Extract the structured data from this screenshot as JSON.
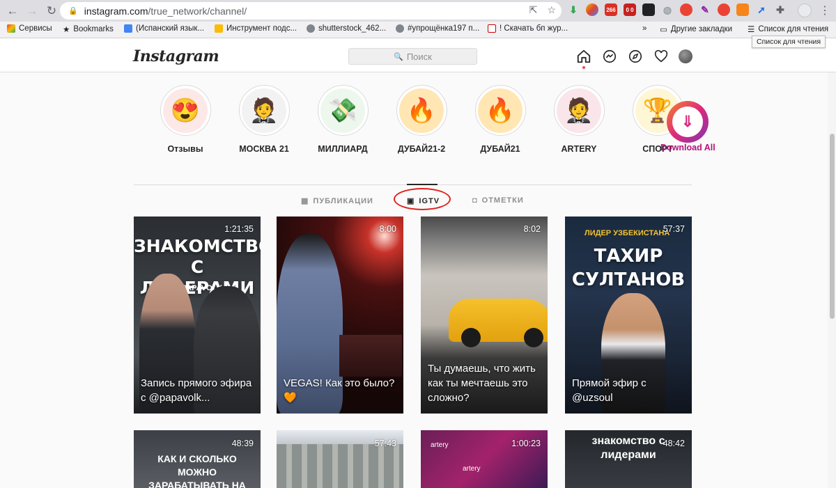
{
  "browser": {
    "url_host": "instagram.com",
    "url_path": "/true_network/channel/",
    "ext_badges": [
      "266",
      "0 0"
    ],
    "bookmarks": [
      {
        "label": "Сервисы"
      },
      {
        "label": "Bookmarks"
      },
      {
        "label": "(Испанский язык..."
      },
      {
        "label": "Инструмент подс..."
      },
      {
        "label": "shutterstock_462..."
      },
      {
        "label": "#упрощёнка197 п..."
      },
      {
        "label": "! Скачать бп жур..."
      }
    ],
    "bookmarks_more": "»",
    "other_bookmarks": "Другие закладки",
    "reading_list": "Список для чтения",
    "tooltip": "Список для чтения"
  },
  "instagram": {
    "logo": "Instagram",
    "search_placeholder": "Поиск",
    "stories": [
      {
        "label": "Отзывы",
        "emoji": "😍"
      },
      {
        "label": "МОСКВА 21",
        "emoji": "🤵"
      },
      {
        "label": "МИЛЛИАРД",
        "emoji": "💸"
      },
      {
        "label": "ДУБАЙ21-2",
        "emoji": "🔥"
      },
      {
        "label": "ДУБАЙ21",
        "emoji": "🔥"
      },
      {
        "label": "ARTERY",
        "emoji": "🤵"
      },
      {
        "label": "СПОРТ",
        "emoji": "🏆"
      }
    ],
    "download_all": "Download All",
    "tabs": [
      {
        "label": "ПУБЛИКАЦИИ",
        "active": false
      },
      {
        "label": "IGTV",
        "active": true
      },
      {
        "label": "ОТМЕТКИ",
        "active": false
      }
    ],
    "videos": [
      {
        "duration": "1:21:35",
        "title_line1": "ЗНАКОМСТВО",
        "title_line2": "С ЛИДЕРАМИ",
        "handle": "PAPAVOLK",
        "caption": "Запись прямого эфира с @papavolk..."
      },
      {
        "duration": "8:00",
        "caption": "VEGAS! Как это было? 🧡"
      },
      {
        "duration": "8:02",
        "caption": "Ты думаешь, что жить как ты мечтаешь это сложно?"
      },
      {
        "duration": "57:37",
        "subtitle": "ЛИДЕР УЗБЕКИСТАНА",
        "title_line1": "ТАХИР",
        "title_line2": "СУЛТАНОВ",
        "caption": "Прямой эфир с @uzsoul"
      }
    ],
    "videos_row2": [
      {
        "duration": "48:39",
        "text": "КАК И СКОЛЬКО МОЖНО ЗАРАБАТЫВАТЬ НА КРИПТЕ"
      },
      {
        "duration": "57:43"
      },
      {
        "duration": "1:00:23",
        "text": "artery"
      },
      {
        "duration": "48:42",
        "text": "знакомство с лидерами"
      }
    ]
  },
  "colors": {
    "accent_red": "#e0221c",
    "ig_text": "#262626",
    "ig_muted": "#8e8e8e",
    "download_purple": "#b3127d"
  }
}
